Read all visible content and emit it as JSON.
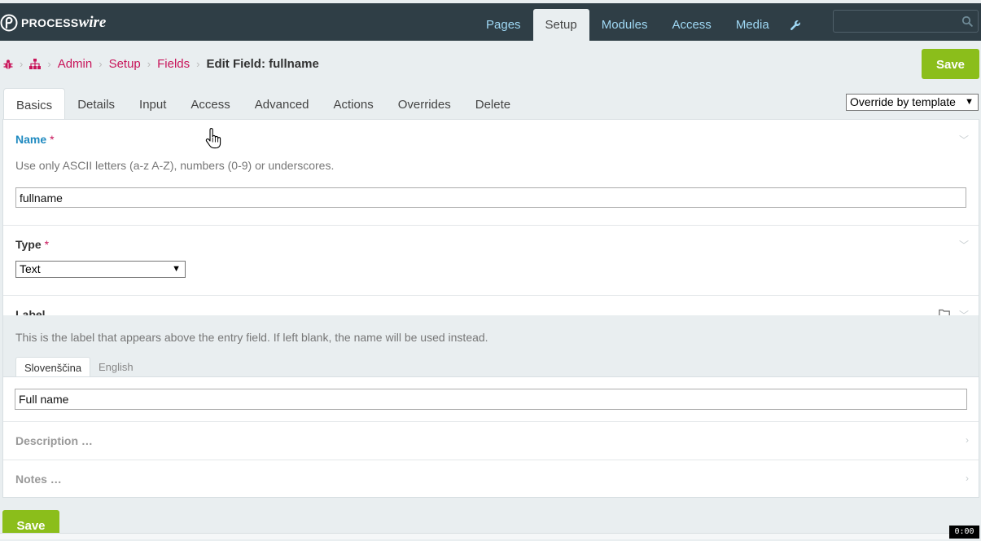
{
  "app": {
    "brand_prefix": "PROCESS",
    "brand_suffix": "wire"
  },
  "nav": {
    "items": [
      "Pages",
      "Setup",
      "Modules",
      "Access",
      "Media"
    ],
    "active": "Setup"
  },
  "search": {
    "placeholder": ""
  },
  "breadcrumb": {
    "items": [
      "Admin",
      "Setup",
      "Fields"
    ],
    "current": "Edit Field: fullname"
  },
  "save_label": "Save",
  "tabs": {
    "items": [
      "Basics",
      "Details",
      "Input",
      "Access",
      "Advanced",
      "Actions",
      "Overrides",
      "Delete"
    ],
    "active": "Basics"
  },
  "override_select": {
    "value": "Override by template"
  },
  "fields": {
    "name": {
      "label": "Name",
      "required": "*",
      "description": "Use only ASCII letters (a-z A-Z), numbers (0-9) or underscores.",
      "value": "fullname"
    },
    "type": {
      "label": "Type",
      "required": "*",
      "value": "Text"
    },
    "label": {
      "label": "Label",
      "description": "This is the label that appears above the entry field. If left blank, the name will be used instead.",
      "languages": [
        "Slovenščina",
        "English"
      ],
      "active_language": "Slovenščina",
      "value": "Full name"
    },
    "description": {
      "label": "Description …"
    },
    "notes": {
      "label": "Notes …"
    }
  },
  "timer": "0:00",
  "colors": {
    "topbar": "#2f3e46",
    "nav_link": "#9fd8f4",
    "accent": "#c8155a",
    "save": "#8bbe1b",
    "label_blue": "#1f8ac0"
  }
}
